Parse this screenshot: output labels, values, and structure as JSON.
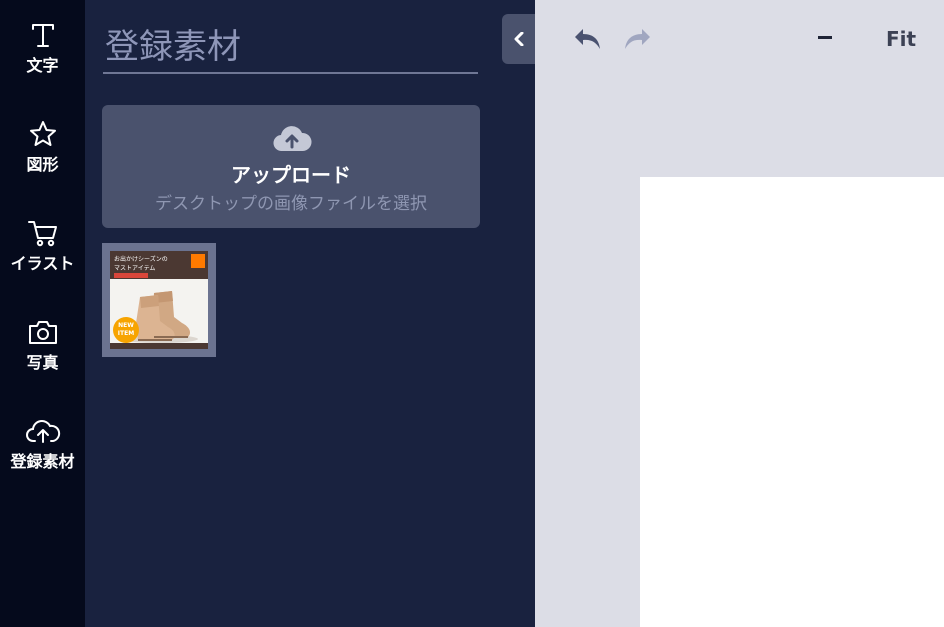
{
  "sidebar": {
    "items": [
      {
        "label": "文字",
        "icon": "text-icon"
      },
      {
        "label": "図形",
        "icon": "star-icon"
      },
      {
        "label": "イラスト",
        "icon": "cart-icon"
      },
      {
        "label": "写真",
        "icon": "camera-icon"
      },
      {
        "label": "登録素材",
        "icon": "cloud-upload-icon"
      }
    ]
  },
  "panel": {
    "title": "登録素材",
    "upload": {
      "title": "アップロード",
      "subtitle": "デスクトップの画像ファイルを選択"
    },
    "thumbnail": {
      "line1": "お出かけシーズンの",
      "line2": "マストアイテム",
      "badge_line1": "NEW",
      "badge_line2": "ITEM"
    }
  },
  "toolbar": {
    "fit_label": "Fit",
    "zoom_out_label": "−"
  },
  "colors": {
    "rail_bg": "#050a1c",
    "panel_bg": "#19223f",
    "upload_bg": "#4a526d",
    "workspace_bg": "#dcdde6",
    "page_bg": "#ffffff"
  }
}
